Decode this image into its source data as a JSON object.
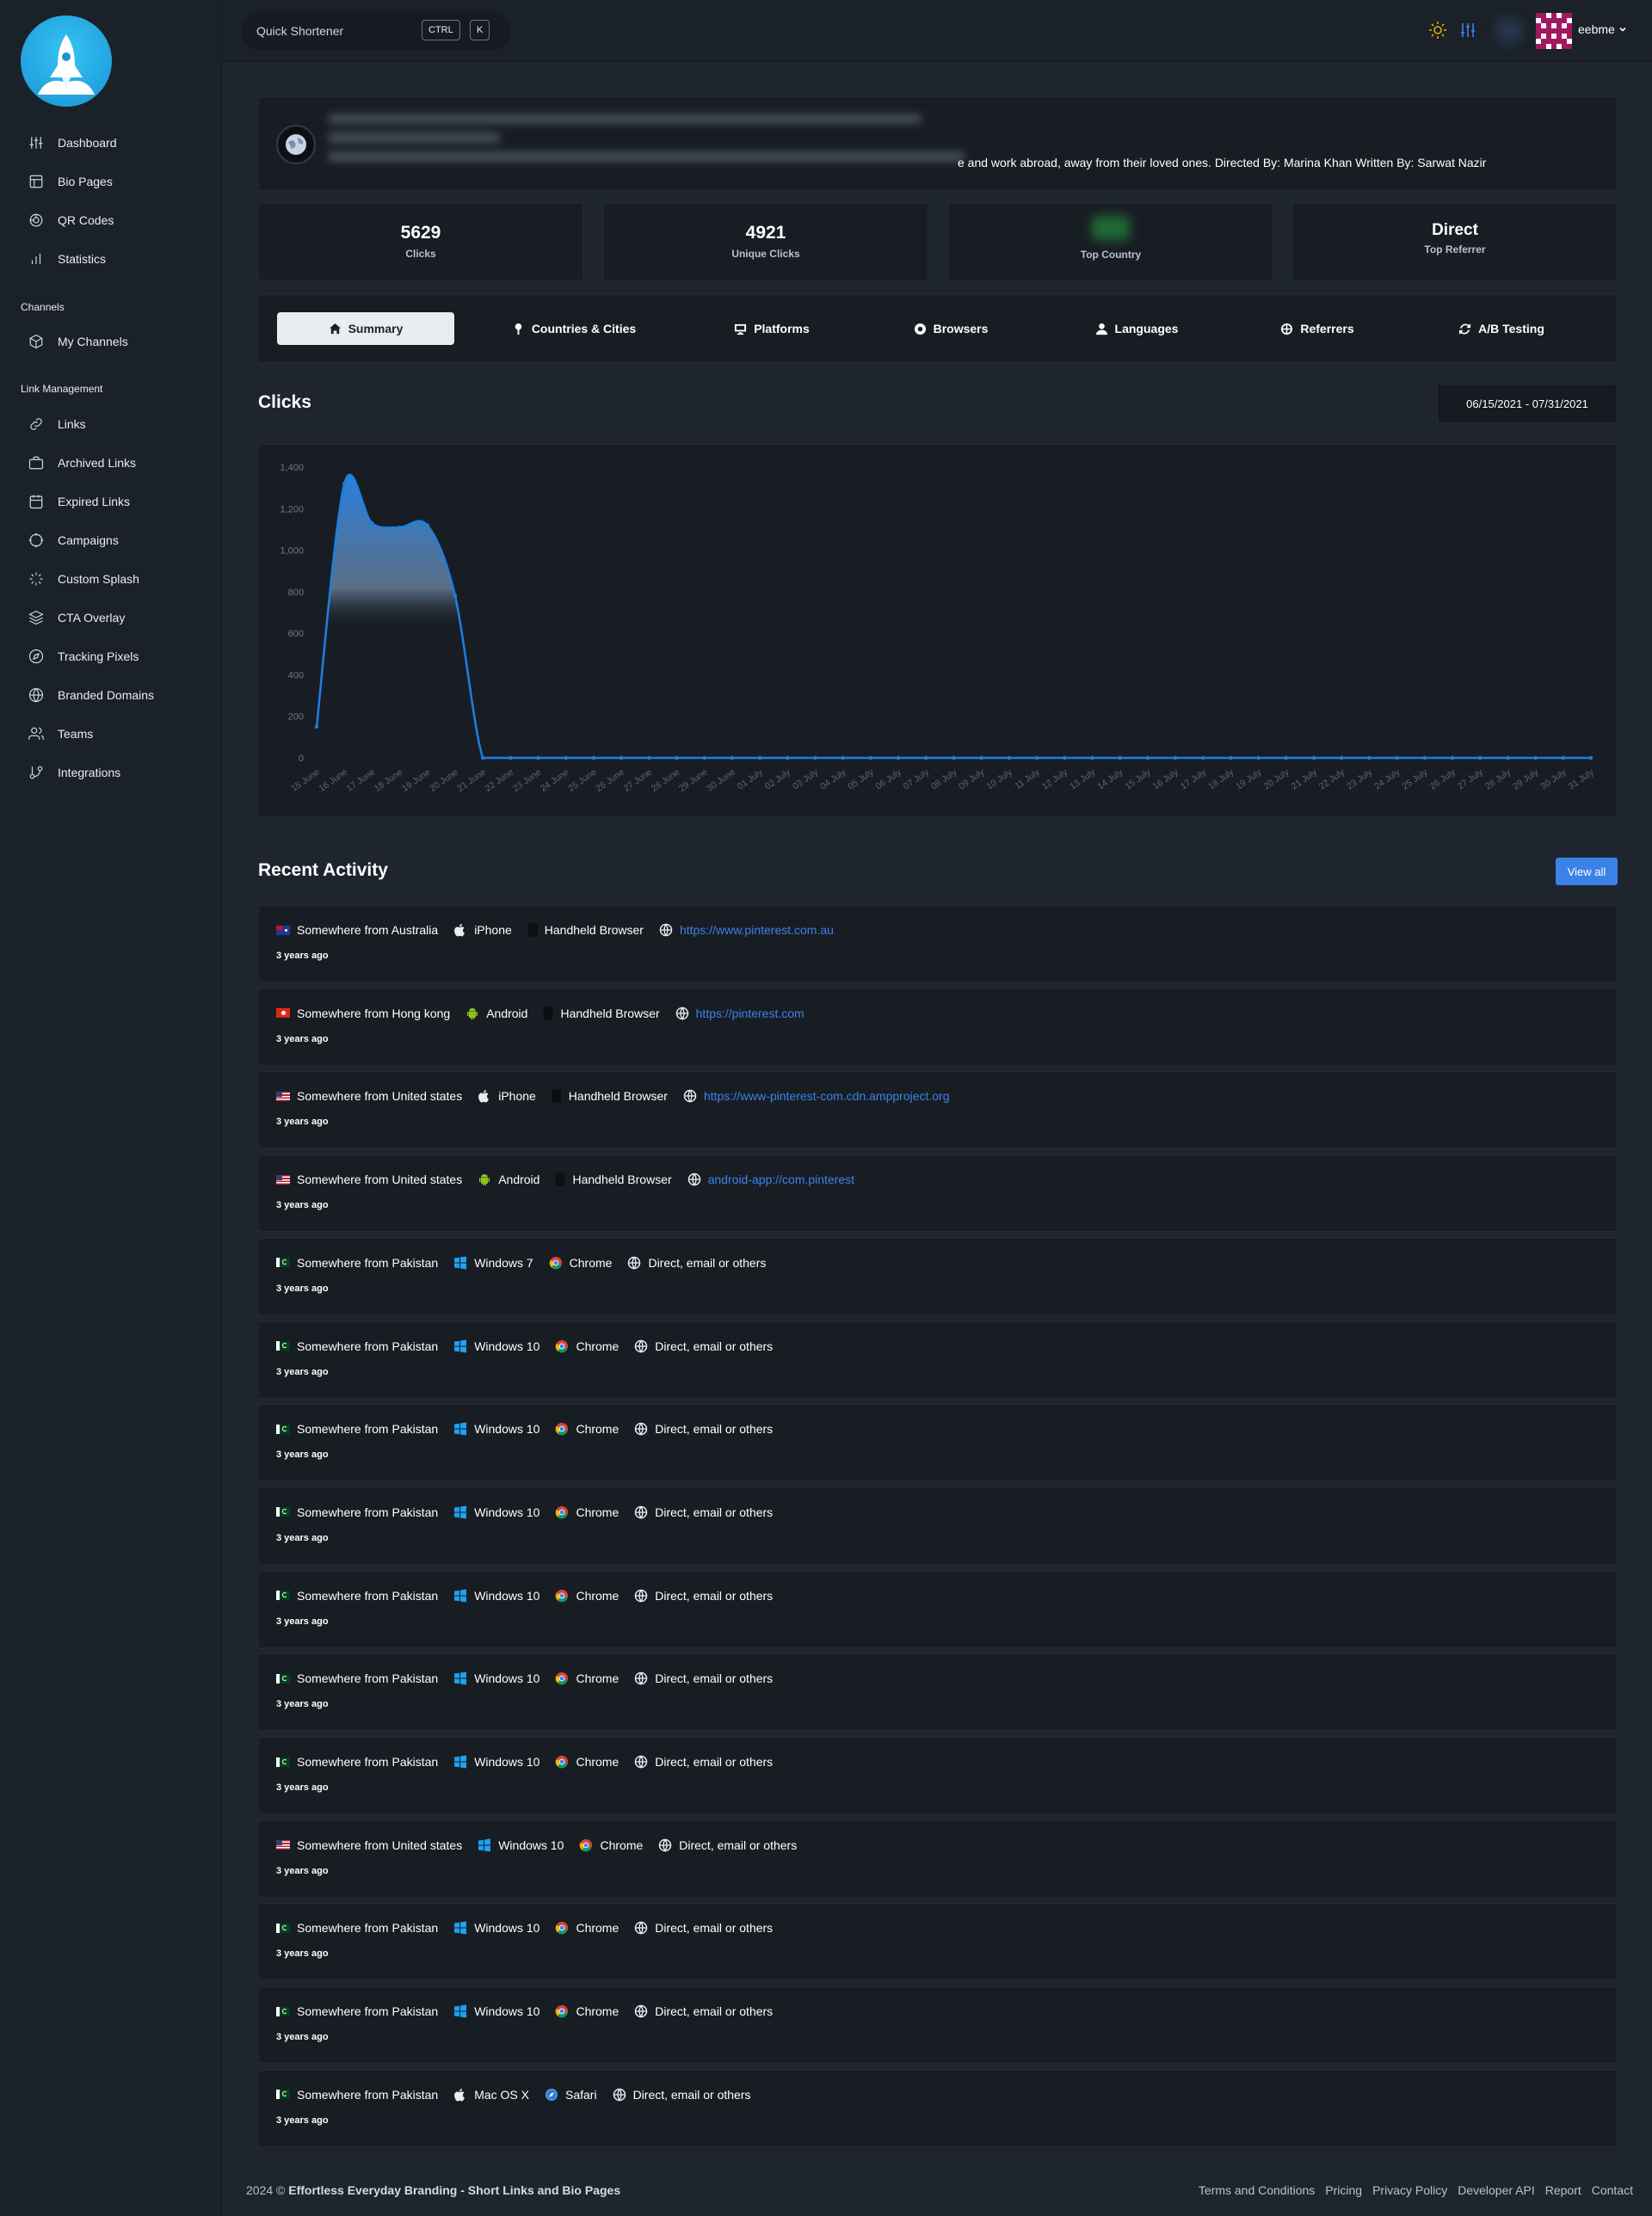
{
  "sidebar": {
    "items": [
      {
        "label": "Dashboard",
        "icon": "sliders-icon"
      },
      {
        "label": "Bio Pages",
        "icon": "layout-icon"
      },
      {
        "label": "QR Codes",
        "icon": "qr-icon"
      },
      {
        "label": "Statistics",
        "icon": "bar-chart-icon"
      }
    ],
    "channels_heading": "Channels",
    "channels": [
      {
        "label": "My Channels",
        "icon": "box-icon"
      }
    ],
    "link_heading": "Link Management",
    "link_items": [
      {
        "label": "Links",
        "icon": "link-icon"
      },
      {
        "label": "Archived Links",
        "icon": "briefcase-icon"
      },
      {
        "label": "Expired Links",
        "icon": "calendar-icon"
      },
      {
        "label": "Campaigns",
        "icon": "target-icon"
      },
      {
        "label": "Custom Splash",
        "icon": "loader-icon"
      },
      {
        "label": "CTA Overlay",
        "icon": "layers-icon"
      },
      {
        "label": "Tracking Pixels",
        "icon": "compass-icon"
      },
      {
        "label": "Branded Domains",
        "icon": "globe-icon"
      },
      {
        "label": "Teams",
        "icon": "users-icon"
      },
      {
        "label": "Integrations",
        "icon": "git-branch-icon"
      }
    ]
  },
  "header": {
    "quick_label": "Quick Shortener",
    "kbd_ctrl": "CTRL",
    "kbd_k": "K",
    "username": "eebme"
  },
  "link": {
    "description": "e and work abroad, away from their loved ones. Directed By: Marina Khan Written By: Sarwat Nazir"
  },
  "stats": {
    "clicks": {
      "value": "5629",
      "label": "Clicks"
    },
    "unique": {
      "value": "4921",
      "label": "Unique Clicks"
    },
    "country": {
      "label": "Top Country"
    },
    "referrer": {
      "value": "Direct",
      "label": "Top Referrer"
    }
  },
  "tabs": [
    {
      "label": "Summary",
      "icon": "home-icon"
    },
    {
      "label": "Countries & Cities",
      "icon": "map-pin-icon"
    },
    {
      "label": "Platforms",
      "icon": "monitor-icon"
    },
    {
      "label": "Browsers",
      "icon": "chrome-icon"
    },
    {
      "label": "Languages",
      "icon": "user-icon"
    },
    {
      "label": "Referrers",
      "icon": "globe-icon"
    },
    {
      "label": "A/B Testing",
      "icon": "refresh-icon"
    }
  ],
  "clicks_section": {
    "title": "Clicks",
    "date_range": "06/15/2021 - 07/31/2021"
  },
  "chart_data": {
    "type": "area",
    "title": "",
    "xlabel": "",
    "ylabel": "",
    "ylim": [
      0,
      1400
    ],
    "yticks": [
      0,
      200,
      400,
      600,
      800,
      1000,
      1200,
      1400
    ],
    "grid": false,
    "x": [
      "15 June",
      "16 June",
      "17 June",
      "18 June",
      "19 June",
      "20 June",
      "21 June",
      "22 June",
      "23 June",
      "24 June",
      "25 June",
      "26 June",
      "27 June",
      "28 June",
      "29 June",
      "30 June",
      "01 July",
      "02 July",
      "03 July",
      "04 July",
      "05 July",
      "06 July",
      "07 July",
      "08 July",
      "09 July",
      "10 July",
      "11 July",
      "12 July",
      "13 July",
      "14 July",
      "15 July",
      "16 July",
      "17 July",
      "18 July",
      "19 July",
      "20 July",
      "21 July",
      "22 July",
      "23 July",
      "24 July",
      "25 July",
      "26 July",
      "27 July",
      "28 July",
      "29 July",
      "30 July",
      "31 July"
    ],
    "values": [
      150,
      1320,
      1130,
      1110,
      1120,
      780,
      0,
      0,
      0,
      0,
      0,
      0,
      0,
      0,
      0,
      0,
      0,
      0,
      0,
      0,
      0,
      0,
      0,
      0,
      0,
      0,
      0,
      0,
      0,
      0,
      0,
      0,
      0,
      0,
      0,
      0,
      0,
      0,
      0,
      0,
      0,
      0,
      0,
      0,
      0,
      0,
      0
    ],
    "color": "#1d7fe0"
  },
  "recent": {
    "title": "Recent Activity",
    "view_all": "View all",
    "items": [
      {
        "flag": "au",
        "location": "Somewhere from Australia",
        "os_icon": "apple-icon",
        "os": "iPhone",
        "browser_icon": "phone-icon",
        "browser": "Handheld Browser",
        "referrer": "https://www.pinterest.com.au",
        "is_link": true,
        "time": "3 years ago"
      },
      {
        "flag": "hk",
        "location": "Somewhere from Hong kong",
        "os_icon": "android-icon",
        "os": "Android",
        "browser_icon": "phone-icon",
        "browser": "Handheld Browser",
        "referrer": "https://pinterest.com",
        "is_link": true,
        "time": "3 years ago"
      },
      {
        "flag": "us",
        "location": "Somewhere from United states",
        "os_icon": "apple-icon",
        "os": "iPhone",
        "browser_icon": "phone-icon",
        "browser": "Handheld Browser",
        "referrer": "https://www-pinterest-com.cdn.ampproject.org",
        "is_link": true,
        "time": "3 years ago"
      },
      {
        "flag": "us",
        "location": "Somewhere from United states",
        "os_icon": "android-icon",
        "os": "Android",
        "browser_icon": "phone-icon",
        "browser": "Handheld Browser",
        "referrer": "android-app://com.pinterest",
        "is_link": true,
        "time": "3 years ago"
      },
      {
        "flag": "pk",
        "location": "Somewhere from Pakistan",
        "os_icon": "windows-icon",
        "os": "Windows 7",
        "browser_icon": "chrome-icon",
        "browser": "Chrome",
        "referrer": "Direct, email or others",
        "is_link": false,
        "time": "3 years ago"
      },
      {
        "flag": "pk",
        "location": "Somewhere from Pakistan",
        "os_icon": "windows-icon",
        "os": "Windows 10",
        "browser_icon": "chrome-icon",
        "browser": "Chrome",
        "referrer": "Direct, email or others",
        "is_link": false,
        "time": "3 years ago"
      },
      {
        "flag": "pk",
        "location": "Somewhere from Pakistan",
        "os_icon": "windows-icon",
        "os": "Windows 10",
        "browser_icon": "chrome-icon",
        "browser": "Chrome",
        "referrer": "Direct, email or others",
        "is_link": false,
        "time": "3 years ago"
      },
      {
        "flag": "pk",
        "location": "Somewhere from Pakistan",
        "os_icon": "windows-icon",
        "os": "Windows 10",
        "browser_icon": "chrome-icon",
        "browser": "Chrome",
        "referrer": "Direct, email or others",
        "is_link": false,
        "time": "3 years ago"
      },
      {
        "flag": "pk",
        "location": "Somewhere from Pakistan",
        "os_icon": "windows-icon",
        "os": "Windows 10",
        "browser_icon": "chrome-icon",
        "browser": "Chrome",
        "referrer": "Direct, email or others",
        "is_link": false,
        "time": "3 years ago"
      },
      {
        "flag": "pk",
        "location": "Somewhere from Pakistan",
        "os_icon": "windows-icon",
        "os": "Windows 10",
        "browser_icon": "chrome-icon",
        "browser": "Chrome",
        "referrer": "Direct, email or others",
        "is_link": false,
        "time": "3 years ago"
      },
      {
        "flag": "pk",
        "location": "Somewhere from Pakistan",
        "os_icon": "windows-icon",
        "os": "Windows 10",
        "browser_icon": "chrome-icon",
        "browser": "Chrome",
        "referrer": "Direct, email or others",
        "is_link": false,
        "time": "3 years ago"
      },
      {
        "flag": "us",
        "location": "Somewhere from United states",
        "os_icon": "windows-icon",
        "os": "Windows 10",
        "browser_icon": "chrome-icon",
        "browser": "Chrome",
        "referrer": "Direct, email or others",
        "is_link": false,
        "time": "3 years ago"
      },
      {
        "flag": "pk",
        "location": "Somewhere from Pakistan",
        "os_icon": "windows-icon",
        "os": "Windows 10",
        "browser_icon": "chrome-icon",
        "browser": "Chrome",
        "referrer": "Direct, email or others",
        "is_link": false,
        "time": "3 years ago"
      },
      {
        "flag": "pk",
        "location": "Somewhere from Pakistan",
        "os_icon": "windows-icon",
        "os": "Windows 10",
        "browser_icon": "chrome-icon",
        "browser": "Chrome",
        "referrer": "Direct, email or others",
        "is_link": false,
        "time": "3 years ago"
      },
      {
        "flag": "pk",
        "location": "Somewhere from Pakistan",
        "os_icon": "apple-icon",
        "os": "Mac OS X",
        "browser_icon": "safari-icon",
        "browser": "Safari",
        "referrer": "Direct, email or others",
        "is_link": false,
        "time": "3 years ago"
      }
    ]
  },
  "footer": {
    "year_text": "2024 © ",
    "brand": "Effortless Everyday Branding - Short Links and Bio Pages",
    "links": [
      "Terms and Conditions",
      "Pricing",
      "Privacy Policy",
      "Developer API",
      "Report",
      "Contact"
    ]
  }
}
